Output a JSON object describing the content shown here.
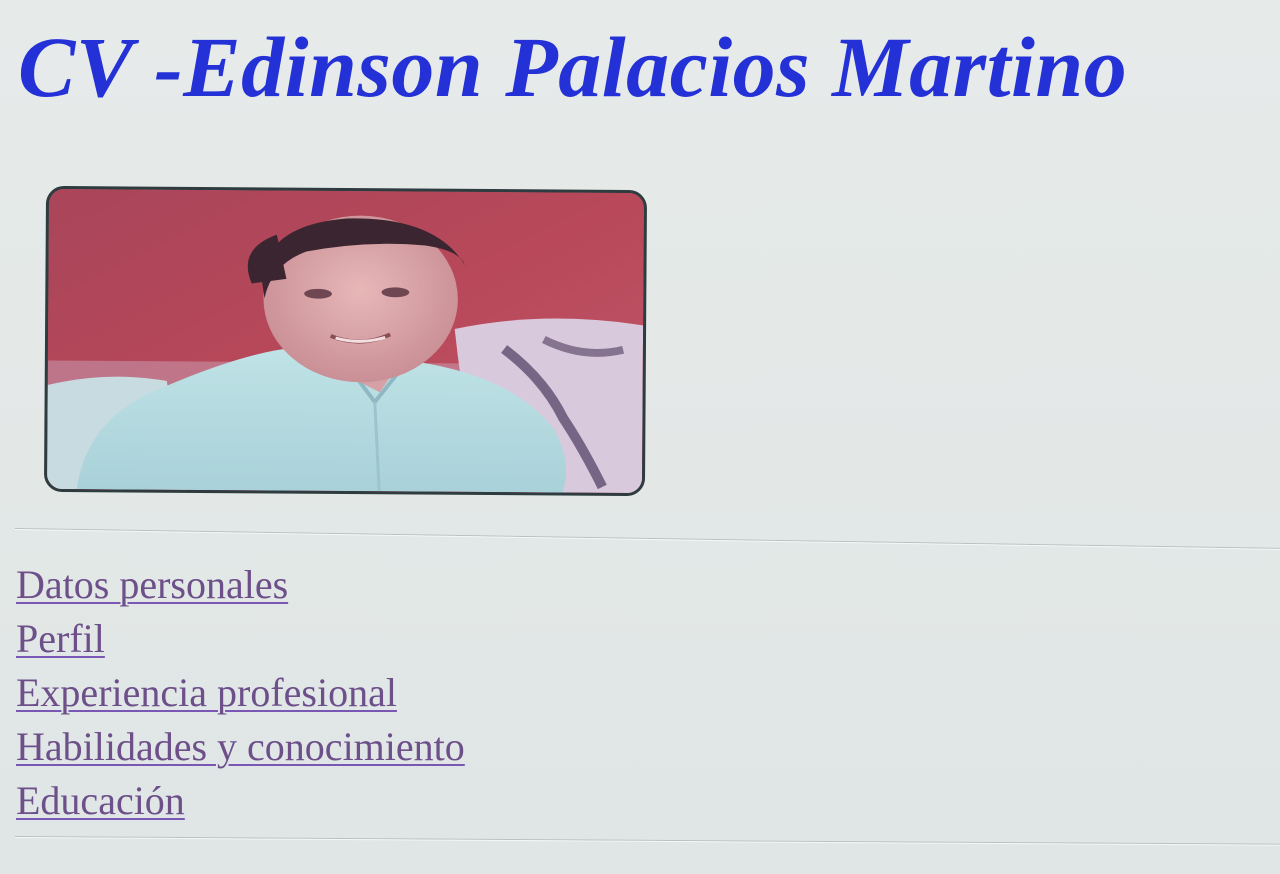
{
  "page": {
    "title": "CV -Edinson Palacios Martino"
  },
  "profile_photo": {
    "alt": "Foto de Edinson Palacios Martino"
  },
  "nav": {
    "items": [
      {
        "label": "Datos personales"
      },
      {
        "label": "Perfil"
      },
      {
        "label": "Experiencia profesional"
      },
      {
        "label": "Habilidades y conocimiento"
      },
      {
        "label": "Educación"
      }
    ]
  },
  "colors": {
    "title": "#2431d6",
    "link": "#6d4f8a",
    "background": "#e5eae9"
  }
}
